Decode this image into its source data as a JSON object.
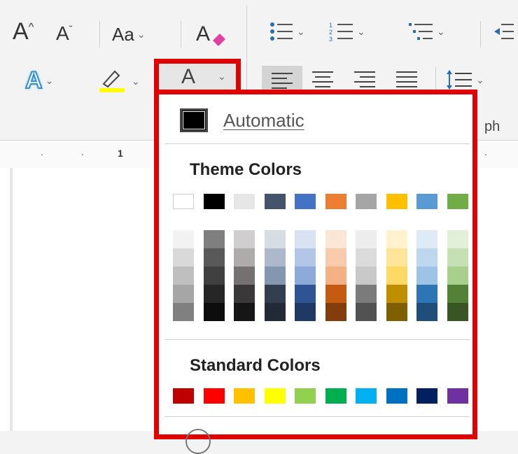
{
  "ribbon": {
    "grow_font_label": "A",
    "shrink_font_label": "A",
    "change_case_label": "Aa",
    "font_color_letter": "A",
    "text_effects_letter": "A",
    "paragraph_label": "ph",
    "ruler_marks": [
      ".",
      ".",
      "1",
      ".",
      "."
    ]
  },
  "font_color_menu": {
    "automatic_label": "Automatic",
    "theme_colors_label": "Theme Colors",
    "standard_colors_label": "Standard Colors",
    "theme_top_row": [
      "#ffffff",
      "#000000",
      "#e7e6e6",
      "#44546a",
      "#4472c4",
      "#ed7d31",
      "#a5a5a5",
      "#ffc000",
      "#5b9bd5",
      "#70ad47"
    ],
    "theme_shades": [
      [
        "#f2f2f2",
        "#d9d9d9",
        "#bfbfbf",
        "#a6a6a6",
        "#808080"
      ],
      [
        "#7f7f7f",
        "#595959",
        "#404040",
        "#262626",
        "#0d0d0d"
      ],
      [
        "#d0cece",
        "#aeabab",
        "#757171",
        "#3a3838",
        "#161616"
      ],
      [
        "#d6dce4",
        "#adb9ca",
        "#8497b0",
        "#333f4f",
        "#222a35"
      ],
      [
        "#d9e2f3",
        "#b4c6e7",
        "#8eaadb",
        "#2f5496",
        "#1f3864"
      ],
      [
        "#fbe5d5",
        "#f7cbac",
        "#f4b183",
        "#c55a11",
        "#833c0b"
      ],
      [
        "#ededed",
        "#dbdbdb",
        "#c9c9c9",
        "#7b7b7b",
        "#525252"
      ],
      [
        "#fff2cc",
        "#fee599",
        "#ffd966",
        "#bf8f00",
        "#7f6000"
      ],
      [
        "#deebf6",
        "#bdd7ee",
        "#9dc3e6",
        "#2e75b5",
        "#1e4e79"
      ],
      [
        "#e2efd9",
        "#c5e0b3",
        "#a8d08d",
        "#538135",
        "#375623"
      ]
    ],
    "standard_colors": [
      "#c00000",
      "#ff0000",
      "#ffc000",
      "#ffff00",
      "#92d050",
      "#00b050",
      "#00b0f0",
      "#0070c0",
      "#002060",
      "#7030a0"
    ],
    "font_color_underline": "#e00000",
    "highlight_color": "#ffff00"
  }
}
